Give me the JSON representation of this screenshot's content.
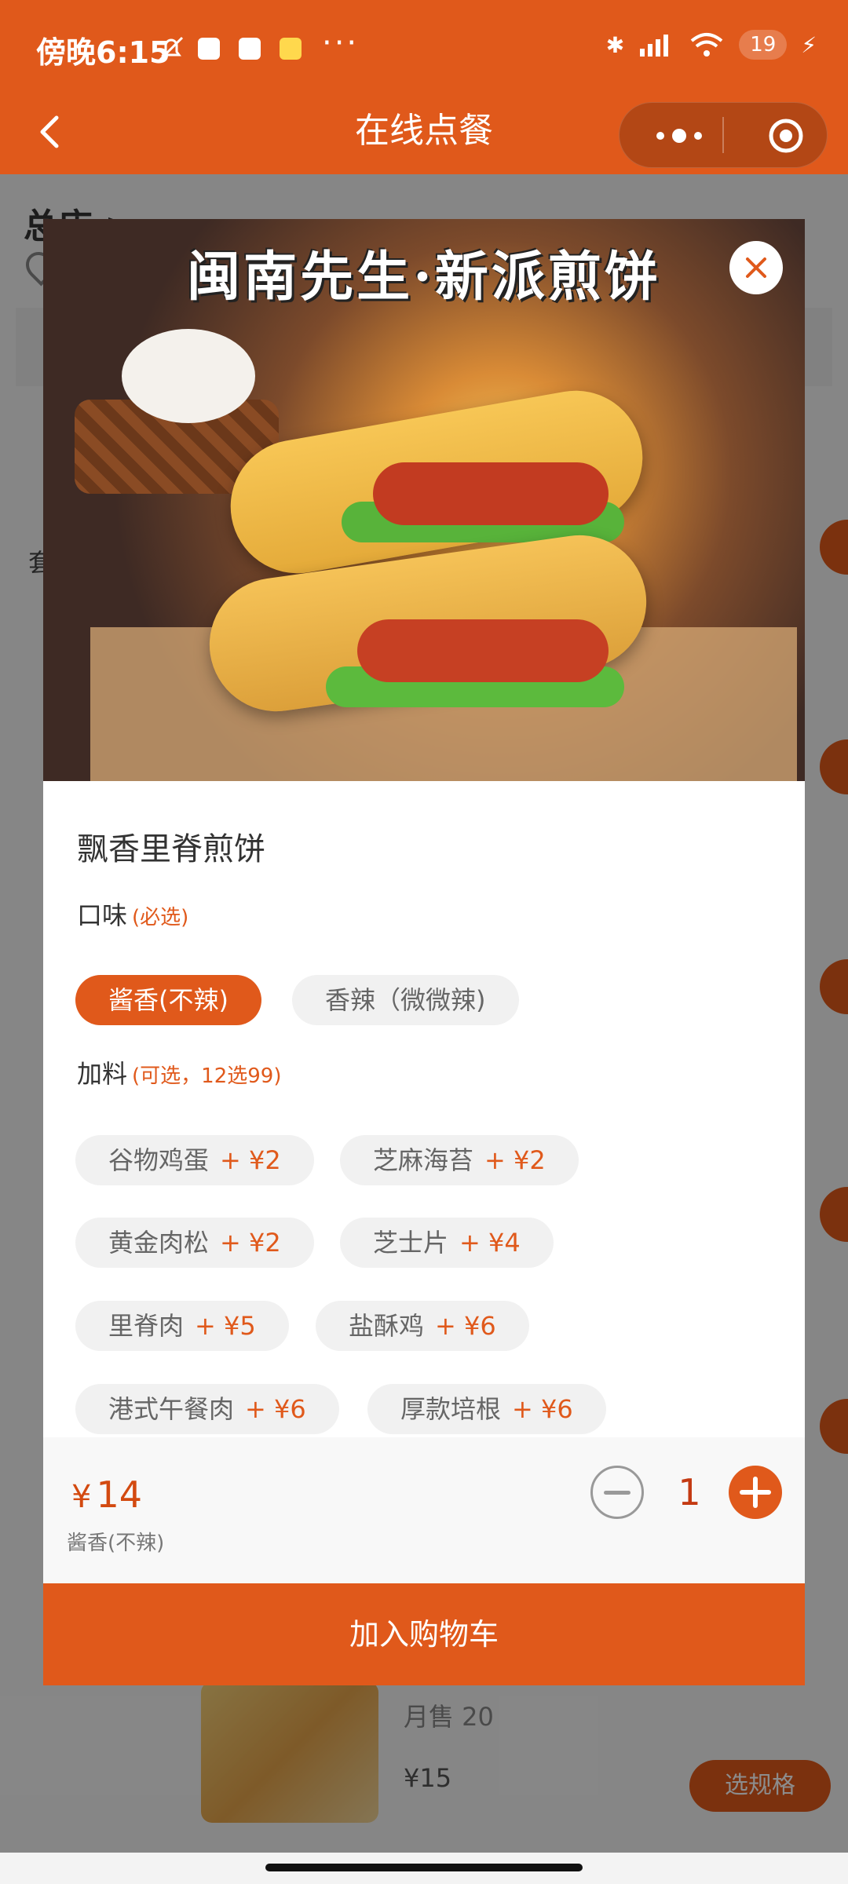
{
  "status_bar": {
    "time": "傍晚6:15",
    "more_dots": "···",
    "battery": "19"
  },
  "nav": {
    "title": "在线点餐",
    "back_icon": "chevron-left-icon",
    "more_icon": "more-dots-icon",
    "target_icon": "target-icon"
  },
  "background_page": {
    "store_name": "总店 >",
    "side_label": "套",
    "item_sold": "月售 20",
    "item_price": "¥15",
    "item_button": "选规格"
  },
  "modal": {
    "hero_title": "闽南先生·新派煎饼",
    "product_name": "飘香里脊煎饼",
    "flavor": {
      "label": "口味",
      "note": "(必选)",
      "options": [
        "酱香(不辣)",
        "香辣（微微辣)"
      ],
      "selected_index": 0
    },
    "toppings": {
      "label": "加料",
      "note": "(可选，12选99)",
      "options": [
        {
          "name": "谷物鸡蛋",
          "price": "+ ¥2"
        },
        {
          "name": "芝麻海苔",
          "price": "+ ¥2"
        },
        {
          "name": "黄金肉松",
          "price": "+ ¥2"
        },
        {
          "name": "芝士片",
          "price": "+ ¥4"
        },
        {
          "name": "里脊肉",
          "price": "+ ¥5"
        },
        {
          "name": "盐酥鸡",
          "price": "+ ¥6"
        },
        {
          "name": "港式午餐肉",
          "price": "+ ¥6"
        },
        {
          "name": "厚款培根",
          "price": "+ ¥6"
        }
      ]
    },
    "price_symbol": "¥",
    "price_value": "14",
    "selected_spec": "酱香(不辣)",
    "quantity": "1",
    "add_to_cart": "加入购物车"
  },
  "colors": {
    "brand": "#e0591b",
    "price": "#d34a10"
  }
}
